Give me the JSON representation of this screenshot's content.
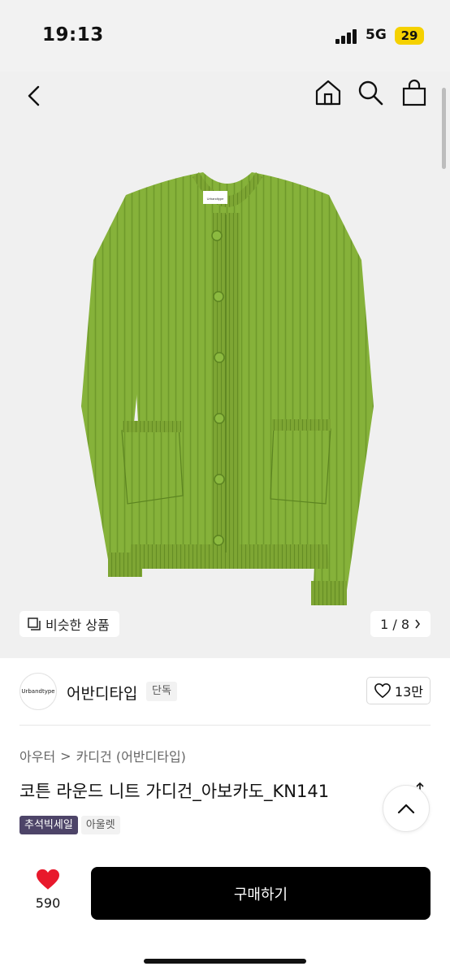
{
  "status_bar": {
    "time": "19:13",
    "network": "5G",
    "battery": "29",
    "battery_color": "#f5d100"
  },
  "header": {
    "icons": [
      "back-icon",
      "home-icon",
      "search-icon",
      "cart-icon"
    ]
  },
  "hero": {
    "background": "#f0f0f0",
    "product_color": "#86b23a",
    "logo_text": "Urbandtype",
    "similar_label": "비슷한 상품",
    "pager": {
      "current": 1,
      "total": 8,
      "label": "1 / 8"
    }
  },
  "brand": {
    "logo_text": "Urbandtype",
    "name": "어반디타입",
    "badge": "단독",
    "like_count": "13만"
  },
  "breadcrumb": {
    "category": "아우터",
    "separator": ">",
    "subcategory": "카디건 (어반디타입)"
  },
  "product": {
    "title": "코튼 라운드 니트 가디건_아보카도_KN141",
    "tags": [
      "추석빅세일",
      "아울렛"
    ],
    "tag_sale_color": "#4d4468"
  },
  "bottom_bar": {
    "heart_color": "#e8192c",
    "like_count": "590",
    "buy_label": "구매하기"
  }
}
